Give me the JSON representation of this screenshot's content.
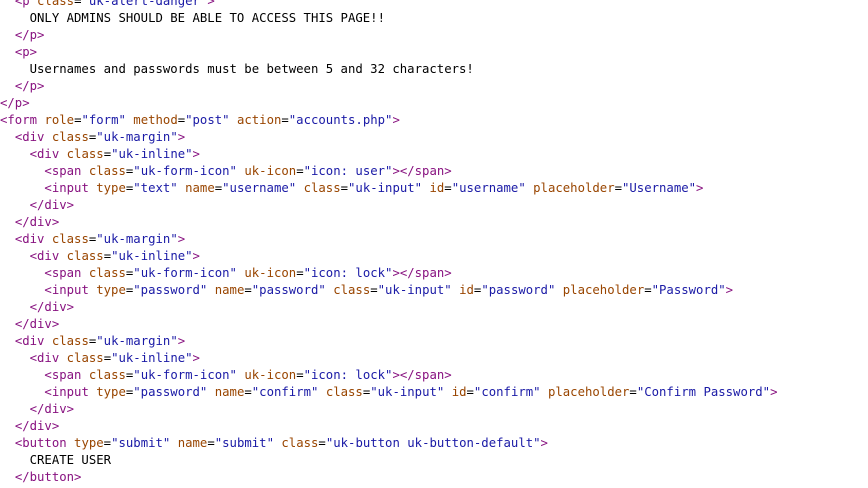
{
  "colors": {
    "tag": "#881280",
    "attribute_name": "#994500",
    "attribute_value": "#1a1aa6",
    "text": "#000000",
    "background": "#ffffff"
  },
  "source_lines": [
    [
      {
        "t": "txt",
        "s": "  "
      },
      {
        "t": "tag",
        "s": "<p"
      },
      {
        "t": "txt",
        "s": " "
      },
      {
        "t": "attr",
        "s": "class"
      },
      {
        "t": "txt",
        "s": "="
      },
      {
        "t": "val",
        "s": "\"uk-alert-danger\""
      },
      {
        "t": "tag",
        "s": ">"
      }
    ],
    [
      {
        "t": "txt",
        "s": "    ONLY ADMINS SHOULD BE ABLE TO ACCESS THIS PAGE!!"
      }
    ],
    [
      {
        "t": "txt",
        "s": "  "
      },
      {
        "t": "tag",
        "s": "</p>"
      }
    ],
    [
      {
        "t": "txt",
        "s": "  "
      },
      {
        "t": "tag",
        "s": "<p>"
      }
    ],
    [
      {
        "t": "txt",
        "s": "    Usernames and passwords must be between 5 and 32 characters!"
      }
    ],
    [
      {
        "t": "txt",
        "s": "  "
      },
      {
        "t": "tag",
        "s": "</p>"
      }
    ],
    [
      {
        "t": "tag",
        "s": "</p>"
      }
    ],
    [
      {
        "t": "tag",
        "s": "<form"
      },
      {
        "t": "txt",
        "s": " "
      },
      {
        "t": "attr",
        "s": "role"
      },
      {
        "t": "txt",
        "s": "="
      },
      {
        "t": "val",
        "s": "\"form\""
      },
      {
        "t": "txt",
        "s": " "
      },
      {
        "t": "attr",
        "s": "method"
      },
      {
        "t": "txt",
        "s": "="
      },
      {
        "t": "val",
        "s": "\"post\""
      },
      {
        "t": "txt",
        "s": " "
      },
      {
        "t": "attr",
        "s": "action"
      },
      {
        "t": "txt",
        "s": "="
      },
      {
        "t": "val",
        "s": "\"accounts.php\""
      },
      {
        "t": "tag",
        "s": ">"
      }
    ],
    [
      {
        "t": "txt",
        "s": "  "
      },
      {
        "t": "tag",
        "s": "<div"
      },
      {
        "t": "txt",
        "s": " "
      },
      {
        "t": "attr",
        "s": "class"
      },
      {
        "t": "txt",
        "s": "="
      },
      {
        "t": "val",
        "s": "\"uk-margin\""
      },
      {
        "t": "tag",
        "s": ">"
      }
    ],
    [
      {
        "t": "txt",
        "s": "    "
      },
      {
        "t": "tag",
        "s": "<div"
      },
      {
        "t": "txt",
        "s": " "
      },
      {
        "t": "attr",
        "s": "class"
      },
      {
        "t": "txt",
        "s": "="
      },
      {
        "t": "val",
        "s": "\"uk-inline\""
      },
      {
        "t": "tag",
        "s": ">"
      }
    ],
    [
      {
        "t": "txt",
        "s": "      "
      },
      {
        "t": "tag",
        "s": "<span"
      },
      {
        "t": "txt",
        "s": " "
      },
      {
        "t": "attr",
        "s": "class"
      },
      {
        "t": "txt",
        "s": "="
      },
      {
        "t": "val",
        "s": "\"uk-form-icon\""
      },
      {
        "t": "txt",
        "s": " "
      },
      {
        "t": "attr",
        "s": "uk-icon"
      },
      {
        "t": "txt",
        "s": "="
      },
      {
        "t": "val",
        "s": "\"icon: user\""
      },
      {
        "t": "tag",
        "s": "></span>"
      }
    ],
    [
      {
        "t": "txt",
        "s": "      "
      },
      {
        "t": "tag",
        "s": "<input"
      },
      {
        "t": "txt",
        "s": " "
      },
      {
        "t": "attr",
        "s": "type"
      },
      {
        "t": "txt",
        "s": "="
      },
      {
        "t": "val",
        "s": "\"text\""
      },
      {
        "t": "txt",
        "s": " "
      },
      {
        "t": "attr",
        "s": "name"
      },
      {
        "t": "txt",
        "s": "="
      },
      {
        "t": "val",
        "s": "\"username\""
      },
      {
        "t": "txt",
        "s": " "
      },
      {
        "t": "attr",
        "s": "class"
      },
      {
        "t": "txt",
        "s": "="
      },
      {
        "t": "val",
        "s": "\"uk-input\""
      },
      {
        "t": "txt",
        "s": " "
      },
      {
        "t": "attr",
        "s": "id"
      },
      {
        "t": "txt",
        "s": "="
      },
      {
        "t": "val",
        "s": "\"username\""
      },
      {
        "t": "txt",
        "s": " "
      },
      {
        "t": "attr",
        "s": "placeholder"
      },
      {
        "t": "txt",
        "s": "="
      },
      {
        "t": "val",
        "s": "\"Username\""
      },
      {
        "t": "tag",
        "s": ">"
      }
    ],
    [
      {
        "t": "txt",
        "s": "    "
      },
      {
        "t": "tag",
        "s": "</div>"
      }
    ],
    [
      {
        "t": "txt",
        "s": "  "
      },
      {
        "t": "tag",
        "s": "</div>"
      }
    ],
    [
      {
        "t": "txt",
        "s": "  "
      },
      {
        "t": "tag",
        "s": "<div"
      },
      {
        "t": "txt",
        "s": " "
      },
      {
        "t": "attr",
        "s": "class"
      },
      {
        "t": "txt",
        "s": "="
      },
      {
        "t": "val",
        "s": "\"uk-margin\""
      },
      {
        "t": "tag",
        "s": ">"
      }
    ],
    [
      {
        "t": "txt",
        "s": "    "
      },
      {
        "t": "tag",
        "s": "<div"
      },
      {
        "t": "txt",
        "s": " "
      },
      {
        "t": "attr",
        "s": "class"
      },
      {
        "t": "txt",
        "s": "="
      },
      {
        "t": "val",
        "s": "\"uk-inline\""
      },
      {
        "t": "tag",
        "s": ">"
      }
    ],
    [
      {
        "t": "txt",
        "s": "      "
      },
      {
        "t": "tag",
        "s": "<span"
      },
      {
        "t": "txt",
        "s": " "
      },
      {
        "t": "attr",
        "s": "class"
      },
      {
        "t": "txt",
        "s": "="
      },
      {
        "t": "val",
        "s": "\"uk-form-icon\""
      },
      {
        "t": "txt",
        "s": " "
      },
      {
        "t": "attr",
        "s": "uk-icon"
      },
      {
        "t": "txt",
        "s": "="
      },
      {
        "t": "val",
        "s": "\"icon: lock\""
      },
      {
        "t": "tag",
        "s": "></span>"
      }
    ],
    [
      {
        "t": "txt",
        "s": "      "
      },
      {
        "t": "tag",
        "s": "<input"
      },
      {
        "t": "txt",
        "s": " "
      },
      {
        "t": "attr",
        "s": "type"
      },
      {
        "t": "txt",
        "s": "="
      },
      {
        "t": "val",
        "s": "\"password\""
      },
      {
        "t": "txt",
        "s": " "
      },
      {
        "t": "attr",
        "s": "name"
      },
      {
        "t": "txt",
        "s": "="
      },
      {
        "t": "val",
        "s": "\"password\""
      },
      {
        "t": "txt",
        "s": " "
      },
      {
        "t": "attr",
        "s": "class"
      },
      {
        "t": "txt",
        "s": "="
      },
      {
        "t": "val",
        "s": "\"uk-input\""
      },
      {
        "t": "txt",
        "s": " "
      },
      {
        "t": "attr",
        "s": "id"
      },
      {
        "t": "txt",
        "s": "="
      },
      {
        "t": "val",
        "s": "\"password\""
      },
      {
        "t": "txt",
        "s": " "
      },
      {
        "t": "attr",
        "s": "placeholder"
      },
      {
        "t": "txt",
        "s": "="
      },
      {
        "t": "val",
        "s": "\"Password\""
      },
      {
        "t": "tag",
        "s": ">"
      }
    ],
    [
      {
        "t": "txt",
        "s": "    "
      },
      {
        "t": "tag",
        "s": "</div>"
      }
    ],
    [
      {
        "t": "txt",
        "s": "  "
      },
      {
        "t": "tag",
        "s": "</div>"
      }
    ],
    [
      {
        "t": "txt",
        "s": "  "
      },
      {
        "t": "tag",
        "s": "<div"
      },
      {
        "t": "txt",
        "s": " "
      },
      {
        "t": "attr",
        "s": "class"
      },
      {
        "t": "txt",
        "s": "="
      },
      {
        "t": "val",
        "s": "\"uk-margin\""
      },
      {
        "t": "tag",
        "s": ">"
      }
    ],
    [
      {
        "t": "txt",
        "s": "    "
      },
      {
        "t": "tag",
        "s": "<div"
      },
      {
        "t": "txt",
        "s": " "
      },
      {
        "t": "attr",
        "s": "class"
      },
      {
        "t": "txt",
        "s": "="
      },
      {
        "t": "val",
        "s": "\"uk-inline\""
      },
      {
        "t": "tag",
        "s": ">"
      }
    ],
    [
      {
        "t": "txt",
        "s": "      "
      },
      {
        "t": "tag",
        "s": "<span"
      },
      {
        "t": "txt",
        "s": " "
      },
      {
        "t": "attr",
        "s": "class"
      },
      {
        "t": "txt",
        "s": "="
      },
      {
        "t": "val",
        "s": "\"uk-form-icon\""
      },
      {
        "t": "txt",
        "s": " "
      },
      {
        "t": "attr",
        "s": "uk-icon"
      },
      {
        "t": "txt",
        "s": "="
      },
      {
        "t": "val",
        "s": "\"icon: lock\""
      },
      {
        "t": "tag",
        "s": "></span>"
      }
    ],
    [
      {
        "t": "txt",
        "s": "      "
      },
      {
        "t": "tag",
        "s": "<input"
      },
      {
        "t": "txt",
        "s": " "
      },
      {
        "t": "attr",
        "s": "type"
      },
      {
        "t": "txt",
        "s": "="
      },
      {
        "t": "val",
        "s": "\"password\""
      },
      {
        "t": "txt",
        "s": " "
      },
      {
        "t": "attr",
        "s": "name"
      },
      {
        "t": "txt",
        "s": "="
      },
      {
        "t": "val",
        "s": "\"confirm\""
      },
      {
        "t": "txt",
        "s": " "
      },
      {
        "t": "attr",
        "s": "class"
      },
      {
        "t": "txt",
        "s": "="
      },
      {
        "t": "val",
        "s": "\"uk-input\""
      },
      {
        "t": "txt",
        "s": " "
      },
      {
        "t": "attr",
        "s": "id"
      },
      {
        "t": "txt",
        "s": "="
      },
      {
        "t": "val",
        "s": "\"confirm\""
      },
      {
        "t": "txt",
        "s": " "
      },
      {
        "t": "attr",
        "s": "placeholder"
      },
      {
        "t": "txt",
        "s": "="
      },
      {
        "t": "val",
        "s": "\"Confirm Password\""
      },
      {
        "t": "tag",
        "s": ">"
      }
    ],
    [
      {
        "t": "txt",
        "s": "    "
      },
      {
        "t": "tag",
        "s": "</div>"
      }
    ],
    [
      {
        "t": "txt",
        "s": "  "
      },
      {
        "t": "tag",
        "s": "</div>"
      }
    ],
    [
      {
        "t": "txt",
        "s": "  "
      },
      {
        "t": "tag",
        "s": "<button"
      },
      {
        "t": "txt",
        "s": " "
      },
      {
        "t": "attr",
        "s": "type"
      },
      {
        "t": "txt",
        "s": "="
      },
      {
        "t": "val",
        "s": "\"submit\""
      },
      {
        "t": "txt",
        "s": " "
      },
      {
        "t": "attr",
        "s": "name"
      },
      {
        "t": "txt",
        "s": "="
      },
      {
        "t": "val",
        "s": "\"submit\""
      },
      {
        "t": "txt",
        "s": " "
      },
      {
        "t": "attr",
        "s": "class"
      },
      {
        "t": "txt",
        "s": "="
      },
      {
        "t": "val",
        "s": "\"uk-button uk-button-default\""
      },
      {
        "t": "tag",
        "s": ">"
      }
    ],
    [
      {
        "t": "txt",
        "s": "    CREATE USER"
      }
    ],
    [
      {
        "t": "txt",
        "s": "  "
      },
      {
        "t": "tag",
        "s": "</button>"
      }
    ]
  ]
}
